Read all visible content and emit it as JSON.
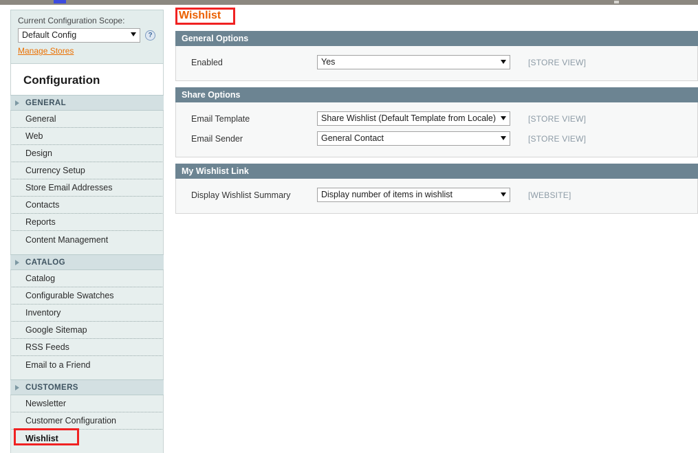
{
  "topnav": {
    "accent_color": "#3c4be0",
    "bar_color": "#8c8880"
  },
  "sidebar": {
    "scope": {
      "label": "Current Configuration Scope:",
      "selected": "Default Config",
      "help_icon": "question-mark-icon",
      "manage_stores_link": "Manage Stores"
    },
    "title": "Configuration",
    "groups": [
      {
        "name": "GENERAL",
        "items": [
          {
            "label": "General",
            "active": false
          },
          {
            "label": "Web",
            "active": false
          },
          {
            "label": "Design",
            "active": false
          },
          {
            "label": "Currency Setup",
            "active": false
          },
          {
            "label": "Store Email Addresses",
            "active": false
          },
          {
            "label": "Contacts",
            "active": false
          },
          {
            "label": "Reports",
            "active": false
          },
          {
            "label": "Content Management",
            "active": false
          }
        ]
      },
      {
        "name": "CATALOG",
        "items": [
          {
            "label": "Catalog",
            "active": false
          },
          {
            "label": "Configurable Swatches",
            "active": false
          },
          {
            "label": "Inventory",
            "active": false
          },
          {
            "label": "Google Sitemap",
            "active": false
          },
          {
            "label": "RSS Feeds",
            "active": false
          },
          {
            "label": "Email to a Friend",
            "active": false
          }
        ]
      },
      {
        "name": "CUSTOMERS",
        "items": [
          {
            "label": "Newsletter",
            "active": false
          },
          {
            "label": "Customer Configuration",
            "active": false
          },
          {
            "label": "Wishlist",
            "active": true
          }
        ]
      }
    ]
  },
  "main": {
    "page_title": "Wishlist",
    "page_title_color": "#eb6000",
    "sections": [
      {
        "header": "General Options",
        "fields": [
          {
            "label": "Enabled",
            "value": "Yes",
            "scope": "[STORE VIEW]"
          }
        ]
      },
      {
        "header": "Share Options",
        "fields": [
          {
            "label": "Email Template",
            "value": "Share Wishlist (Default Template from Locale)",
            "scope": "[STORE VIEW]"
          },
          {
            "label": "Email Sender",
            "value": "General Contact",
            "scope": "[STORE VIEW]"
          }
        ]
      },
      {
        "header": "My Wishlist Link",
        "fields": [
          {
            "label": "Display Wishlist Summary",
            "value": "Display number of items in wishlist",
            "scope": "[WEBSITE]"
          }
        ]
      }
    ]
  },
  "annotations": {
    "color": "#f02222",
    "boxes": [
      "page-title-highlight",
      "sidebar-wishlist-highlight"
    ]
  }
}
